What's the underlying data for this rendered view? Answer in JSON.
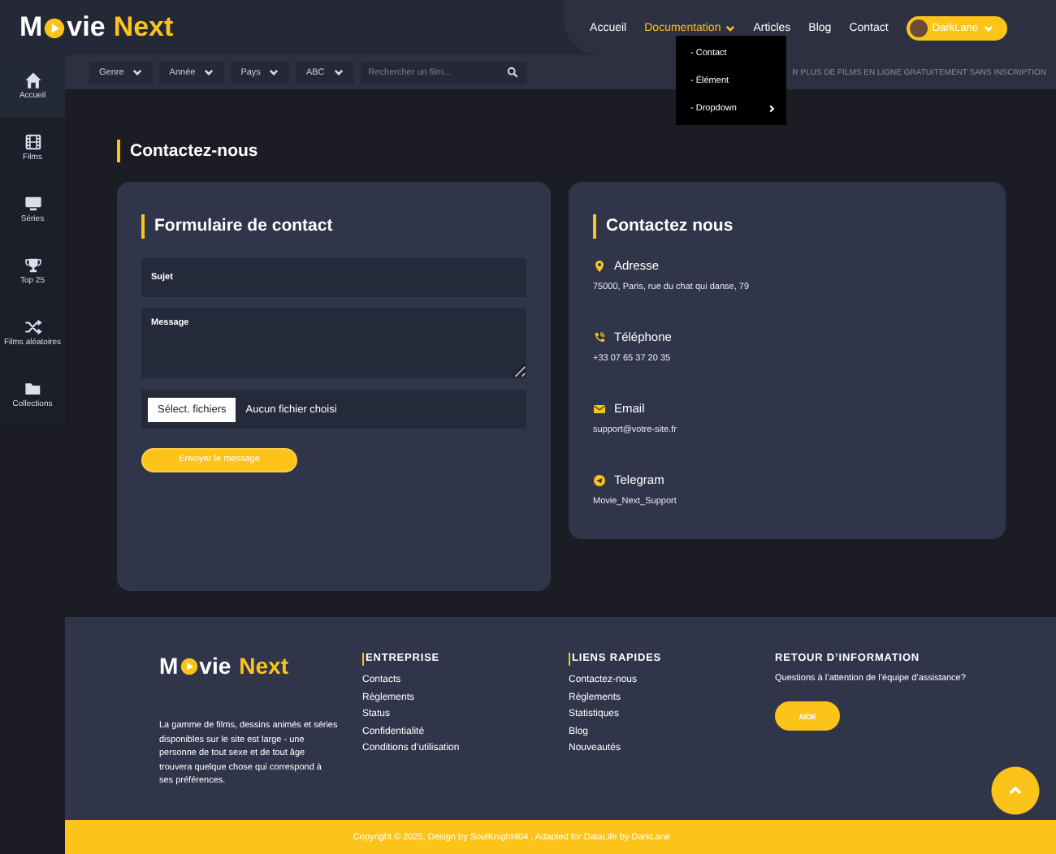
{
  "header": {
    "logo": {
      "first": "M",
      "middle": "vie",
      "last": "Next"
    },
    "nav": [
      {
        "label": "Accueil",
        "selected": false,
        "has_menu": false
      },
      {
        "label": "Documentation",
        "selected": true,
        "has_menu": true
      },
      {
        "label": "Articles",
        "selected": false,
        "has_menu": false
      },
      {
        "label": "Blog",
        "selected": false,
        "has_menu": false
      },
      {
        "label": "Contact",
        "selected": false,
        "has_menu": false
      }
    ],
    "user": {
      "name": "DarkLane"
    }
  },
  "dropdown": {
    "items": [
      {
        "label": "- Contact",
        "has_submenu": false
      },
      {
        "label": "- Élément",
        "has_submenu": false
      },
      {
        "label": "- Dropdown",
        "has_submenu": true
      }
    ]
  },
  "sidebar": {
    "items": [
      {
        "label": "Accueil",
        "kind": "home",
        "selected": true
      },
      {
        "label": "Films",
        "kind": "film",
        "selected": false
      },
      {
        "label": "Séries",
        "kind": "monitor",
        "selected": false
      },
      {
        "label": "Top 25",
        "kind": "trophy",
        "selected": false
      },
      {
        "label": "Films aléatoires",
        "kind": "shuffle",
        "selected": false
      },
      {
        "label": "Collections",
        "kind": "folder",
        "selected": false
      }
    ]
  },
  "filters": [
    "Genre",
    "Année",
    "Pays",
    "ABC"
  ],
  "search": {
    "placeholder": "Rechercher un film..."
  },
  "marquee": "R PLUS DE FILMS EN LIGNE GRATUITEMENT SANS INSCRIPTION",
  "page_title": "Contactez-nous",
  "form": {
    "title": "Formulaire de contact",
    "fields": [
      {
        "kind": "input",
        "placeholder": "Sujet"
      },
      {
        "kind": "textarea",
        "placeholder": "Message"
      }
    ],
    "file": {
      "button": "Sélect. fichiers",
      "status": "Aucun fichier choisi"
    },
    "submit": "Envoyer le message"
  },
  "contact": {
    "title": "Contactez nous",
    "items": [
      {
        "kind": "pin",
        "label": "Adresse",
        "value": "75000, Paris, rue du chat qui danse, 79"
      },
      {
        "kind": "phone",
        "label": "Téléphone",
        "value": "+33 07 65 37 20 35"
      },
      {
        "kind": "mail",
        "label": "Email",
        "value": "support@votre-site.fr"
      },
      {
        "kind": "telegram",
        "label": "Telegram",
        "value": "Movie_Next_Support"
      }
    ]
  },
  "footer": {
    "logo": {
      "first": "M",
      "middle": "vie",
      "last": "Next"
    },
    "about": "La gamme de films, dessins animés et séries disponibles sur le site est large - une personne de tout sexe et de tout âge trouvera quelque chose qui correspond à ses préférences.",
    "columns": [
      {
        "title": "ENTREPRISE",
        "accent": true,
        "links": [
          "Contacts",
          "Règlements",
          "Status",
          "Confidentialité",
          "Conditions d’utilisation"
        ]
      },
      {
        "title": "LIENS RAPIDES",
        "accent": true,
        "links": [
          "Contactez-nous",
          "Règlements",
          "Statistiques",
          "Blog",
          "Nouveautés"
        ]
      }
    ],
    "support": {
      "title": "RETOUR D’INFORMATION",
      "text": "Questions à l’attention de l’équipe d’assistance?",
      "button": "AIDE"
    }
  },
  "copyright": "Copyright © 2025, Design by SoulKnight404 , Adapted for DataLife by DarkLane"
}
